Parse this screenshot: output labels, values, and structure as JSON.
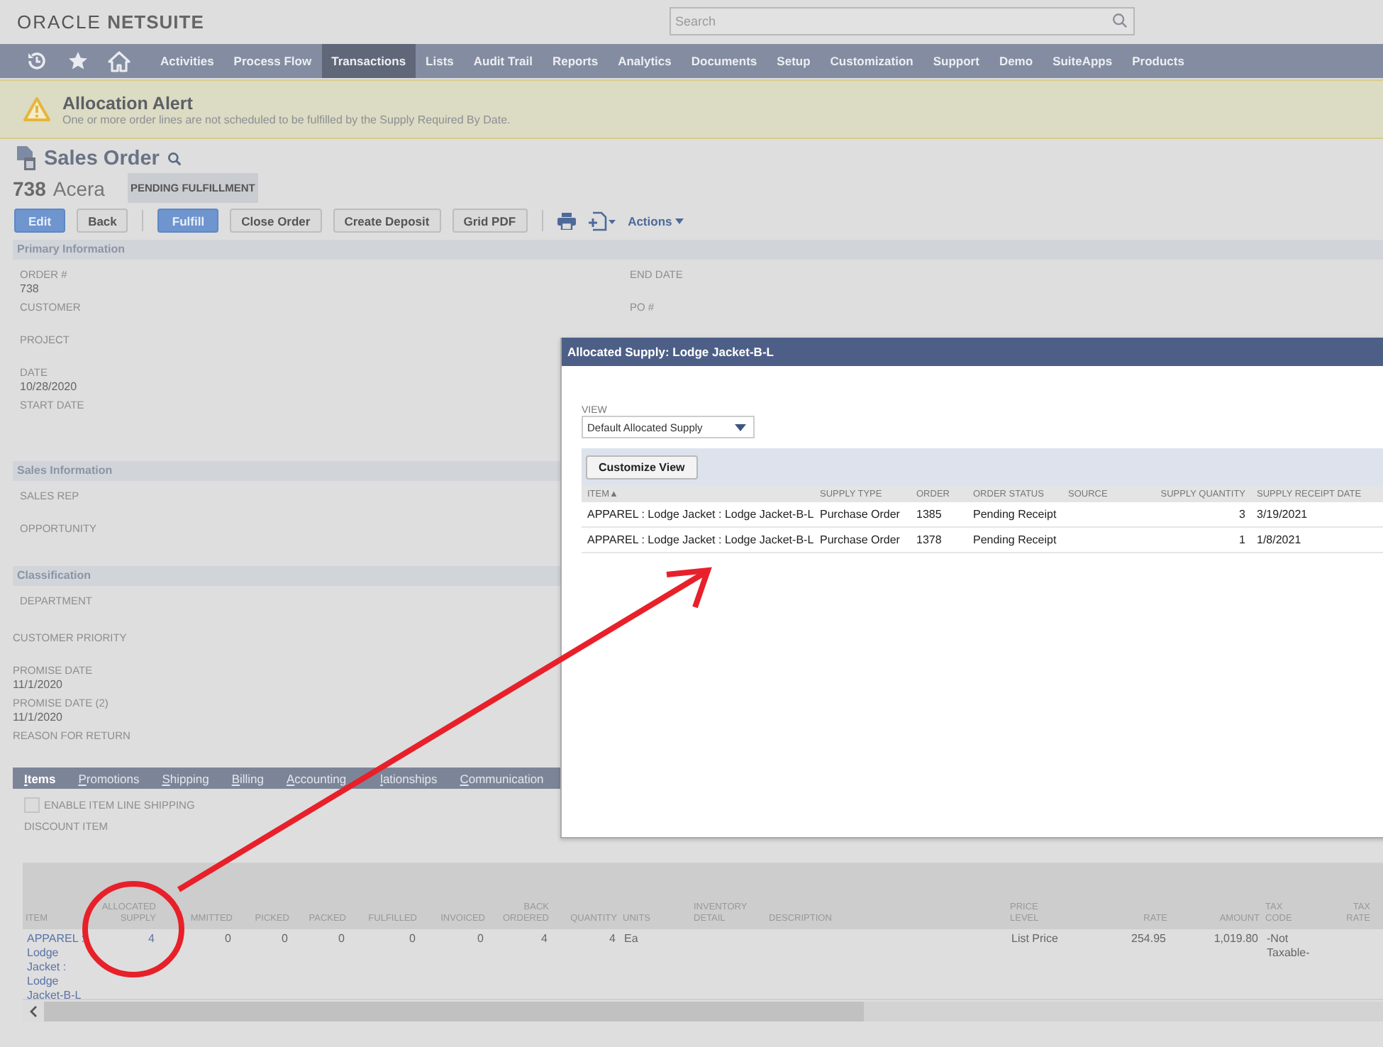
{
  "header": {
    "logo": {
      "brand": "ORACLE",
      "product": "NETSUITE"
    },
    "search": {
      "placeholder": "Search"
    }
  },
  "nav": [
    {
      "label": "Activities",
      "selected": false
    },
    {
      "label": "Process Flow",
      "selected": false
    },
    {
      "label": "Transactions",
      "selected": true
    },
    {
      "label": "Lists",
      "selected": false
    },
    {
      "label": "Audit Trail",
      "selected": false
    },
    {
      "label": "Reports",
      "selected": false
    },
    {
      "label": "Analytics",
      "selected": false
    },
    {
      "label": "Documents",
      "selected": false
    },
    {
      "label": "Setup",
      "selected": false
    },
    {
      "label": "Customization",
      "selected": false
    },
    {
      "label": "Support",
      "selected": false
    },
    {
      "label": "Demo",
      "selected": false
    },
    {
      "label": "SuiteApps",
      "selected": false
    },
    {
      "label": "Products",
      "selected": false
    }
  ],
  "alert": {
    "title": "Allocation Alert",
    "message": "One or more order lines are not scheduled to be fulfilled by the Supply Required By Date."
  },
  "record": {
    "type": "Sales Order",
    "number": "738",
    "name": "Acera",
    "status": "PENDING FULFILLMENT"
  },
  "toolbar": [
    {
      "kind": "primary",
      "label": "Edit"
    },
    {
      "kind": "default",
      "label": "Back"
    },
    {
      "kind": "separator"
    },
    {
      "kind": "primary",
      "label": "Fulfill"
    },
    {
      "kind": "default",
      "label": "Close Order"
    },
    {
      "kind": "default",
      "label": "Create Deposit"
    },
    {
      "kind": "default",
      "label": "Grid PDF"
    },
    {
      "kind": "separator"
    },
    {
      "kind": "print"
    },
    {
      "kind": "new"
    },
    {
      "kind": "menu",
      "label": "Actions"
    }
  ],
  "sections": [
    {
      "title": "Primary Information",
      "left": [
        {
          "label": "ORDER #",
          "value": "738"
        },
        {
          "label": "CUSTOMER"
        },
        {
          "label": "PROJECT"
        },
        {
          "label": "DATE",
          "value": "10/28/2020"
        },
        {
          "label": "START DATE"
        }
      ],
      "right": [
        {
          "label": "END DATE"
        },
        {
          "label": "PO #"
        }
      ]
    },
    {
      "title": "Sales Information",
      "left": [
        {
          "label": "SALES REP"
        },
        {
          "label": "OPPORTUNITY"
        }
      ]
    },
    {
      "title": "Classification",
      "left": [
        {
          "label": "DEPARTMENT"
        }
      ]
    }
  ],
  "other_fields": [
    {
      "label": "CUSTOMER PRIORITY"
    },
    {
      "label": "PROMISE DATE",
      "value": "11/1/2020"
    },
    {
      "label": "PROMISE DATE (2)",
      "value": "11/1/2020"
    },
    {
      "label": "REASON FOR RETURN"
    }
  ],
  "subtabs": [
    {
      "label": "Items",
      "selected": true
    },
    {
      "label": "Promotions",
      "selected": false
    },
    {
      "label": "Shipping",
      "selected": false
    },
    {
      "label": "Billing",
      "selected": false
    },
    {
      "label": "Accounting",
      "selected": false
    },
    {
      "label": "lationships",
      "selected": false
    },
    {
      "label": "Communication",
      "selected": false
    }
  ],
  "items_tab": {
    "line_shipping": {
      "label": "ENABLE ITEM LINE SHIPPING",
      "checked": false
    },
    "discount_label": "DISCOUNT ITEM"
  },
  "items_table": {
    "columns": [
      "ITEM",
      "ALLOCATED SUPPLY",
      "MMITTED",
      "PICKED",
      "PACKED",
      "FULFILLED",
      "INVOICED",
      "BACK ORDERED",
      "QUANTITY",
      "UNITS",
      "INVENTORY DETAIL",
      "DESCRIPTION",
      "PRICE LEVEL",
      "RATE",
      "AMOUNT",
      "TAX CODE",
      "TAX RATE"
    ],
    "rows": [
      [
        "APPAREL : Lodge Jacket : Lodge Jacket-B-L",
        "4",
        "0",
        "0",
        "0",
        "0",
        "0",
        "4",
        "4",
        "Ea",
        "",
        "",
        "List Price",
        "254.95",
        "1,019.80",
        "-Not Taxable-",
        ""
      ]
    ]
  },
  "popup": {
    "title": "Allocated Supply: Lodge Jacket-B-L",
    "view_label": "VIEW",
    "view_value": "Default Allocated Supply",
    "customize_button": "Customize View",
    "columns": [
      {
        "label": "ITEM",
        "sort": "▲"
      },
      {
        "label": "SUPPLY TYPE"
      },
      {
        "label": "ORDER"
      },
      {
        "label": "ORDER STATUS"
      },
      {
        "label": "SOURCE"
      },
      {
        "label": "SUPPLY QUANTITY"
      },
      {
        "label": "SUPPLY RECEIPT DATE"
      }
    ],
    "rows": [
      [
        "APPAREL : Lodge Jacket : Lodge Jacket-B-L",
        "Purchase Order",
        "1385",
        "Pending Receipt",
        "",
        "3",
        "3/19/2021"
      ],
      [
        "APPAREL : Lodge Jacket : Lodge Jacket-B-L",
        "Purchase Order",
        "1378",
        "Pending Receipt",
        "",
        "1",
        "1/8/2021"
      ]
    ]
  }
}
